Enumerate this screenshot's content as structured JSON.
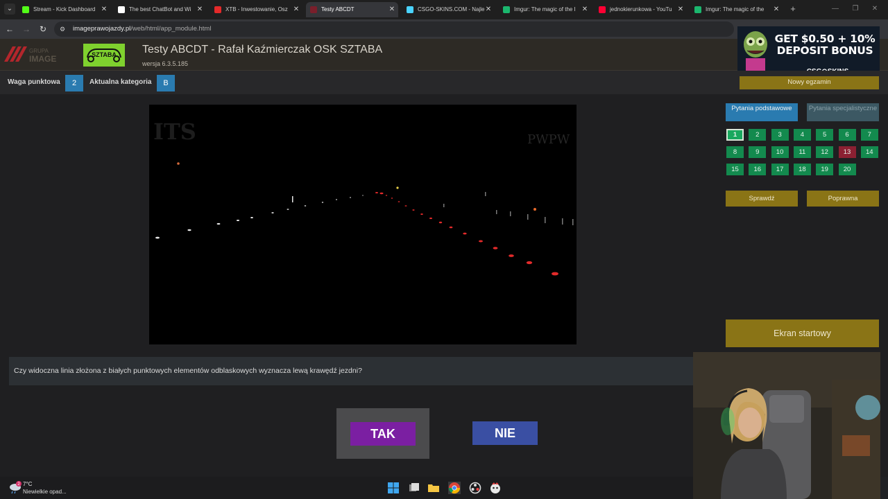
{
  "browser": {
    "tabs": [
      {
        "title": "Stream - Kick Dashboard",
        "icon": "kick-icon",
        "color": "#53fc18"
      },
      {
        "title": "The best ChatBot and Wi",
        "icon": "chatbot-icon",
        "color": "#ffffff"
      },
      {
        "title": "XTB - Inwestowanie, Osz",
        "icon": "xtb-icon",
        "color": "#e42a2a"
      },
      {
        "title": "Testy ABCDT",
        "icon": "testy-icon",
        "color": "#7a1f2b"
      },
      {
        "title": "CSGO-SKINS.COM - Najle",
        "icon": "csgo-skins-icon",
        "color": "#4ad3ff"
      },
      {
        "title": "Imgur: The magic of the I",
        "icon": "imgur-icon",
        "color": "#1bb76e"
      },
      {
        "title": "jednokierunkowa - YouTu",
        "icon": "youtube-icon",
        "color": "#ff0033"
      },
      {
        "title": "Imgur: The magic of the",
        "icon": "imgur-icon",
        "color": "#1bb76e"
      }
    ],
    "active_tab_index": 3,
    "url_host": "imageprawojazdy.pl",
    "url_path": "/web/html/app_module.html"
  },
  "app": {
    "title": "Testy ABCDT - Rafał Kaźmierczak OSK SZTABA",
    "version": "wersja 6.3.5.185",
    "logo_left_line1": "GRUPA",
    "logo_left_line2": "IMAGE",
    "logo_right": "SZTABA"
  },
  "ad": {
    "headline": "GET $0.50 + 10% DEPOSIT BONUS",
    "brand": "CSG⊙SKINS"
  },
  "info": {
    "weight_label": "Waga punktowa",
    "weight_value": "2",
    "category_label": "Aktualna kategoria",
    "category_value": "B"
  },
  "sidebar": {
    "new_exam": "Nowy egzamin",
    "tab_basic": "Pytania podstawowe",
    "tab_specialist": "Pytania specjalistyczne",
    "questions": [
      "1",
      "2",
      "3",
      "4",
      "5",
      "6",
      "7",
      "8",
      "9",
      "10",
      "11",
      "12",
      "13",
      "14",
      "15",
      "16",
      "17",
      "18",
      "19",
      "20"
    ],
    "current_question": "1",
    "wrong_question": "13",
    "check_button": "Sprawdź",
    "correct_button": "Poprawna",
    "start_screen": "Ekran startowy"
  },
  "video": {
    "watermark_left": "ITS",
    "watermark_right": "PWPW"
  },
  "question": {
    "text": "Czy widoczna linia złożona z białych punktowych elementów odblaskowych wyznacza lewą krawędź jezdni?",
    "answer_yes": "TAK",
    "answer_no": "NIE"
  },
  "taskbar": {
    "temperature": "7°C",
    "weather": "Niewielkie opad...",
    "weather_badge": "2"
  }
}
